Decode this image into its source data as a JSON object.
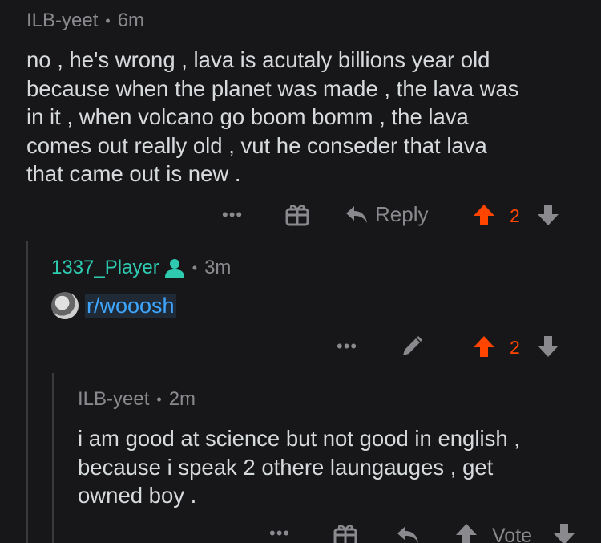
{
  "comment1": {
    "author": "ILB-yeet",
    "separator": "•",
    "time": "6m",
    "body": "no , he's wrong , lava is acutaly billions year old\nbecause when the planet was made , the lava was\nin it , when volcano go boom bomm , the lava\ncomes out really old , vut he conseder that lava\nthat came out is new .",
    "more_label": "•••",
    "reply_label": "Reply",
    "votes": "2"
  },
  "comment2": {
    "author": "1337_Player",
    "separator": "•",
    "time": "3m",
    "link_text": "r/wooosh",
    "more_label": "•••",
    "votes": "2"
  },
  "comment3": {
    "author": "ILB-yeet",
    "separator": "•",
    "time": "2m",
    "body": "i am good at science but not good in english ,\nbecause i speak 2 othere laungauges , get\nowned boy .",
    "more_label": "•••",
    "vote_label": "Vote"
  },
  "colors": {
    "background": "#171719",
    "upvote_active": "#ff4500",
    "username_highlight": "#2ecbb1",
    "link": "#3ea6ff",
    "muted": "#8a8a8e"
  }
}
